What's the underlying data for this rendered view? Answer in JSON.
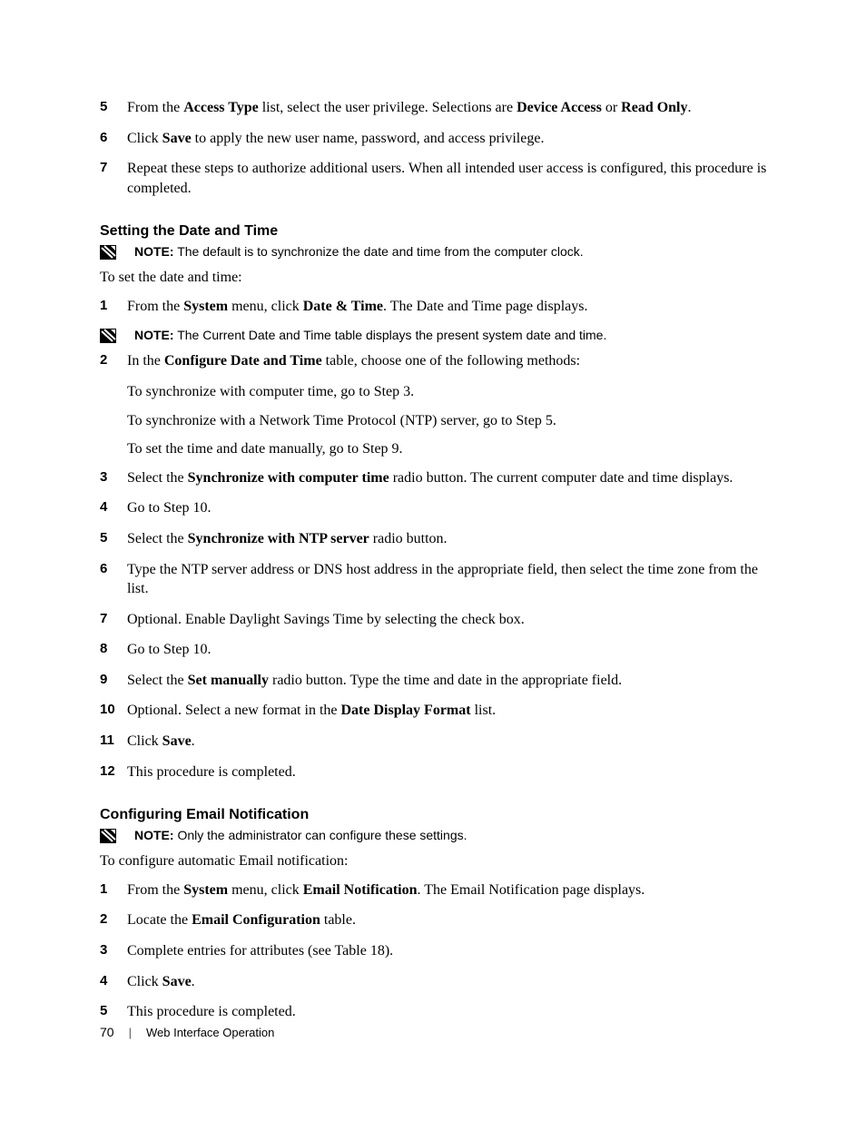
{
  "intro_steps": [
    {
      "n": "5",
      "html": "From the <b>Access Type</b> list, select the user privilege. Selections are <b>Device Access</b> or <b>Read Only</b>."
    },
    {
      "n": "6",
      "html": "Click <b>Save</b> to apply the new user name, password, and access privilege."
    },
    {
      "n": "7",
      "html": "Repeat these steps to authorize additional users. When all intended user access is configured, this procedure is completed."
    }
  ],
  "section1": {
    "heading": "Setting the Date and Time",
    "note": {
      "label": "NOTE:",
      "text": " The default is to synchronize the date and time from the computer clock."
    },
    "intro": "To set the date and time:",
    "steps_a": [
      {
        "n": "1",
        "html": "From the <b>System</b> menu, click <b>Date & Time</b>. The Date and Time page displays."
      }
    ],
    "note2": {
      "label": "NOTE:",
      "text": " The Current Date and Time table displays the present system date and time."
    },
    "steps_b": [
      {
        "n": "2",
        "html": "In the <b>Configure Date and Time</b> table, choose one of the following methods:"
      }
    ],
    "subs": [
      "To synchronize with computer time, go to Step 3.",
      "To synchronize with a Network Time Protocol (NTP) server, go to Step 5.",
      "To set the time and date manually, go to Step 9."
    ],
    "steps_c": [
      {
        "n": "3",
        "html": "Select the <b>Synchronize with computer time</b> radio button. The current computer date and time displays."
      },
      {
        "n": "4",
        "html": "Go to Step 10."
      },
      {
        "n": "5",
        "html": "Select the <b>Synchronize with NTP server</b> radio button."
      },
      {
        "n": "6",
        "html": "Type the NTP server address or DNS host address in the appropriate field, then select the time zone from the list."
      },
      {
        "n": "7",
        "html": "Optional. Enable Daylight Savings Time by selecting the check box."
      },
      {
        "n": "8",
        "html": "Go to Step 10."
      },
      {
        "n": "9",
        "html": "Select the <b>Set manually</b> radio button. Type the time and date in the appropriate field."
      },
      {
        "n": "10",
        "html": "Optional. Select a new format in the <b>Date Display Format</b> list."
      },
      {
        "n": "11",
        "html": "Click <b>Save</b>."
      },
      {
        "n": "12",
        "html": "This procedure is completed."
      }
    ]
  },
  "section2": {
    "heading": "Configuring Email Notification",
    "note": {
      "label": "NOTE:",
      "text": " Only the administrator can configure these settings."
    },
    "intro": "To configure automatic Email notification:",
    "steps": [
      {
        "n": "1",
        "html": "From the <b>System</b> menu, click <b>Email Notification</b>. The Email Notification page displays."
      },
      {
        "n": "2",
        "html": "Locate the <b>Email Configuration</b> table."
      },
      {
        "n": "3",
        "html": "Complete entries for attributes (see Table 18)."
      },
      {
        "n": "4",
        "html": "Click <b>Save</b>."
      },
      {
        "n": "5",
        "html": "This procedure is completed."
      }
    ]
  },
  "footer": {
    "page": "70",
    "title": "Web Interface Operation"
  }
}
